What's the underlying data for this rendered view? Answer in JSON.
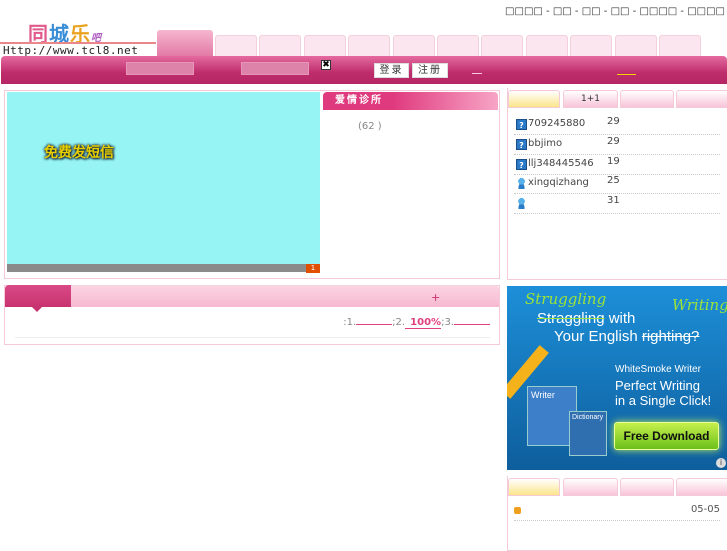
{
  "header": {
    "top_links": [
      "□□□□",
      "□□",
      "□□",
      "□□",
      "□□□□",
      "□□□□"
    ],
    "logo_text": [
      "同",
      "城",
      "乐"
    ],
    "logo_suffix": "吧",
    "url": "Http://www.tcl8.net",
    "nav_tab_count": 12
  },
  "login_bar": {
    "login_label": "登录",
    "register_label": "注册",
    "close_glyph": "✖"
  },
  "flash": {
    "title": "免费发短信",
    "page": "1"
  },
  "love": {
    "title": "爱情诊所",
    "count": "(62  )"
  },
  "ranking": {
    "tabs": [
      "",
      "1+1",
      "",
      ""
    ],
    "items": [
      {
        "icon": "question",
        "name": "709245880",
        "count": "29"
      },
      {
        "icon": "question",
        "name": "bbjimo",
        "count": "29"
      },
      {
        "icon": "question",
        "name": "llj348445546",
        "count": "19"
      },
      {
        "icon": "person",
        "name": "xingqizhang",
        "count": "25"
      },
      {
        "icon": "person",
        "name": "",
        "count": "31"
      }
    ]
  },
  "vote": {
    "plus": "+",
    "p1": ":1.",
    "p2": ";2.",
    "p2_value": "100%",
    "p3": ";3."
  },
  "ad": {
    "strike1": "Straggling",
    "hand1": "Struggling",
    "with": "with",
    "line2": "Your English",
    "strike2": "righting?",
    "hand2": "Writing",
    "brand": "WhiteSmoke Writer",
    "tagline1": "Perfect Writing",
    "tagline2": "in a Single Click!",
    "cta": "Free Download",
    "box1": "Writer",
    "box2": "Dictionary",
    "info": "i"
  },
  "news": {
    "tabs": [
      "",
      "",
      "",
      ""
    ],
    "items": [
      {
        "date": "05-05"
      }
    ]
  }
}
